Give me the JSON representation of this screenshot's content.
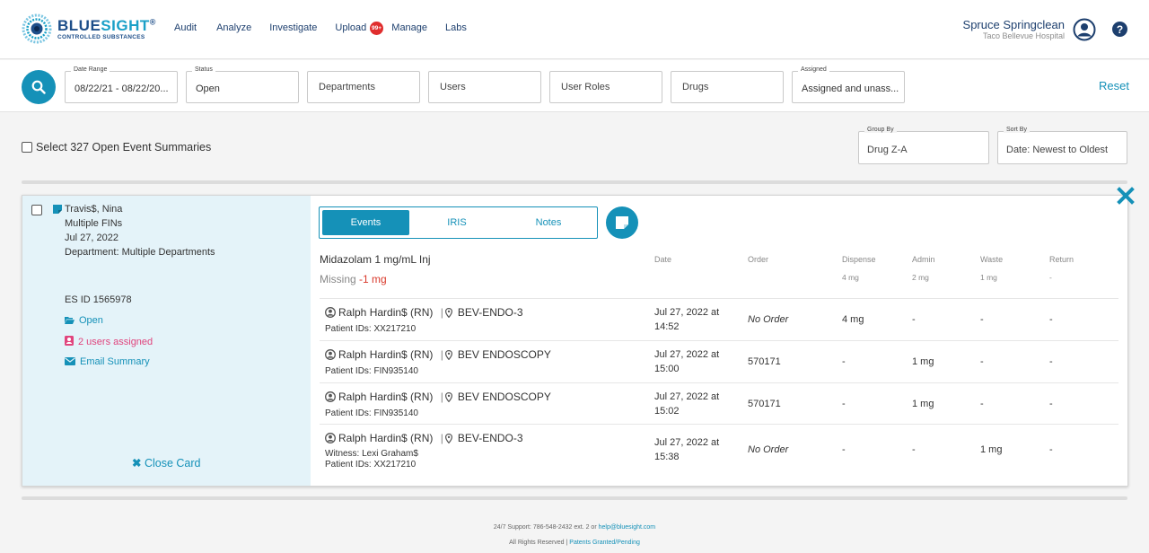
{
  "brand": {
    "word_blue": "BLUE",
    "word_sight": "SIGHT",
    "registered": "®",
    "tagline": "CONTROLLED SUBSTANCES",
    "primary_color": "#1d4e89",
    "accent_color": "#1591b8"
  },
  "nav": {
    "items": [
      "Audit",
      "Analyze",
      "Investigate",
      "Upload",
      "Manage",
      "Labs"
    ],
    "badge": "99+"
  },
  "user": {
    "name": "Spruce Springclean",
    "hospital": "Taco Bellevue Hospital"
  },
  "filters": {
    "date_range_label": "Date Range",
    "date_range_value": "08/22/21 - 08/22/20...",
    "status_label": "Status",
    "status_value": "Open",
    "departments": "Departments",
    "users": "Users",
    "user_roles": "User Roles",
    "drugs": "Drugs",
    "assigned_label": "Assigned",
    "assigned_value": "Assigned and unass...",
    "reset": "Reset"
  },
  "toolbar": {
    "select_all": "Select 327 Open Event Summaries",
    "group_by_label": "Group By",
    "group_by_value": "Drug Z-A",
    "sort_by_label": "Sort By",
    "sort_by_value": "Date: Newest to Oldest"
  },
  "card": {
    "patient_name": "Travis$, Nina",
    "fins": "Multiple FINs",
    "date": "Jul 27, 2022",
    "department_label": "Department:",
    "department_value": "Multiple Departments",
    "es_id": "ES ID 1565978",
    "status_link": "Open",
    "assigned_link": "2 users assigned",
    "email_link": "Email Summary",
    "close_card": "Close Card",
    "tabs": [
      "Events",
      "IRIS",
      "Notes"
    ],
    "active_tab": "Events",
    "drug": "Midazolam 1 mg/mL Inj",
    "missing_label": "Missing",
    "missing_value": "-1 mg",
    "columns": {
      "date": "Date",
      "order": "Order",
      "dispense": "Dispense",
      "admin": "Admin",
      "waste": "Waste",
      "return": "Return"
    },
    "totals": {
      "dispense": "4 mg",
      "admin": "2 mg",
      "waste": "1 mg",
      "return": "-"
    },
    "rows": [
      {
        "person": "Ralph Hardin$ (RN)",
        "location": "BEV-ENDO-3",
        "witness": "",
        "patient_ids": "Patient IDs: XX217210",
        "date_line1": "Jul 27, 2022 at",
        "date_line2": "14:52",
        "order": "No Order",
        "dispense": "4 mg",
        "admin": "-",
        "waste": "-",
        "return": "-"
      },
      {
        "person": "Ralph Hardin$ (RN)",
        "location": "BEV ENDOSCOPY",
        "witness": "",
        "patient_ids": "Patient IDs: FIN935140",
        "date_line1": "Jul 27, 2022 at",
        "date_line2": "15:00",
        "order": "570171",
        "dispense": "-",
        "admin": "1 mg",
        "waste": "-",
        "return": "-"
      },
      {
        "person": "Ralph Hardin$ (RN)",
        "location": "BEV ENDOSCOPY",
        "witness": "",
        "patient_ids": "Patient IDs: FIN935140",
        "date_line1": "Jul 27, 2022 at",
        "date_line2": "15:02",
        "order": "570171",
        "dispense": "-",
        "admin": "1 mg",
        "waste": "-",
        "return": "-"
      },
      {
        "person": "Ralph Hardin$ (RN)",
        "location": "BEV-ENDO-3",
        "witness": "Witness: Lexi Graham$",
        "patient_ids": "Patient IDs: XX217210",
        "date_line1": "Jul 27, 2022 at",
        "date_line2": "15:38",
        "order": "No Order",
        "dispense": "-",
        "admin": "-",
        "waste": "1 mg",
        "return": "-"
      }
    ]
  },
  "footer": {
    "support": "24/7 Support: 786-548-2432 ext. 2 or",
    "support_email": "help@bluesight.com",
    "rights": "All Rights Reserved |",
    "patents": "Patents Granted/Pending"
  }
}
